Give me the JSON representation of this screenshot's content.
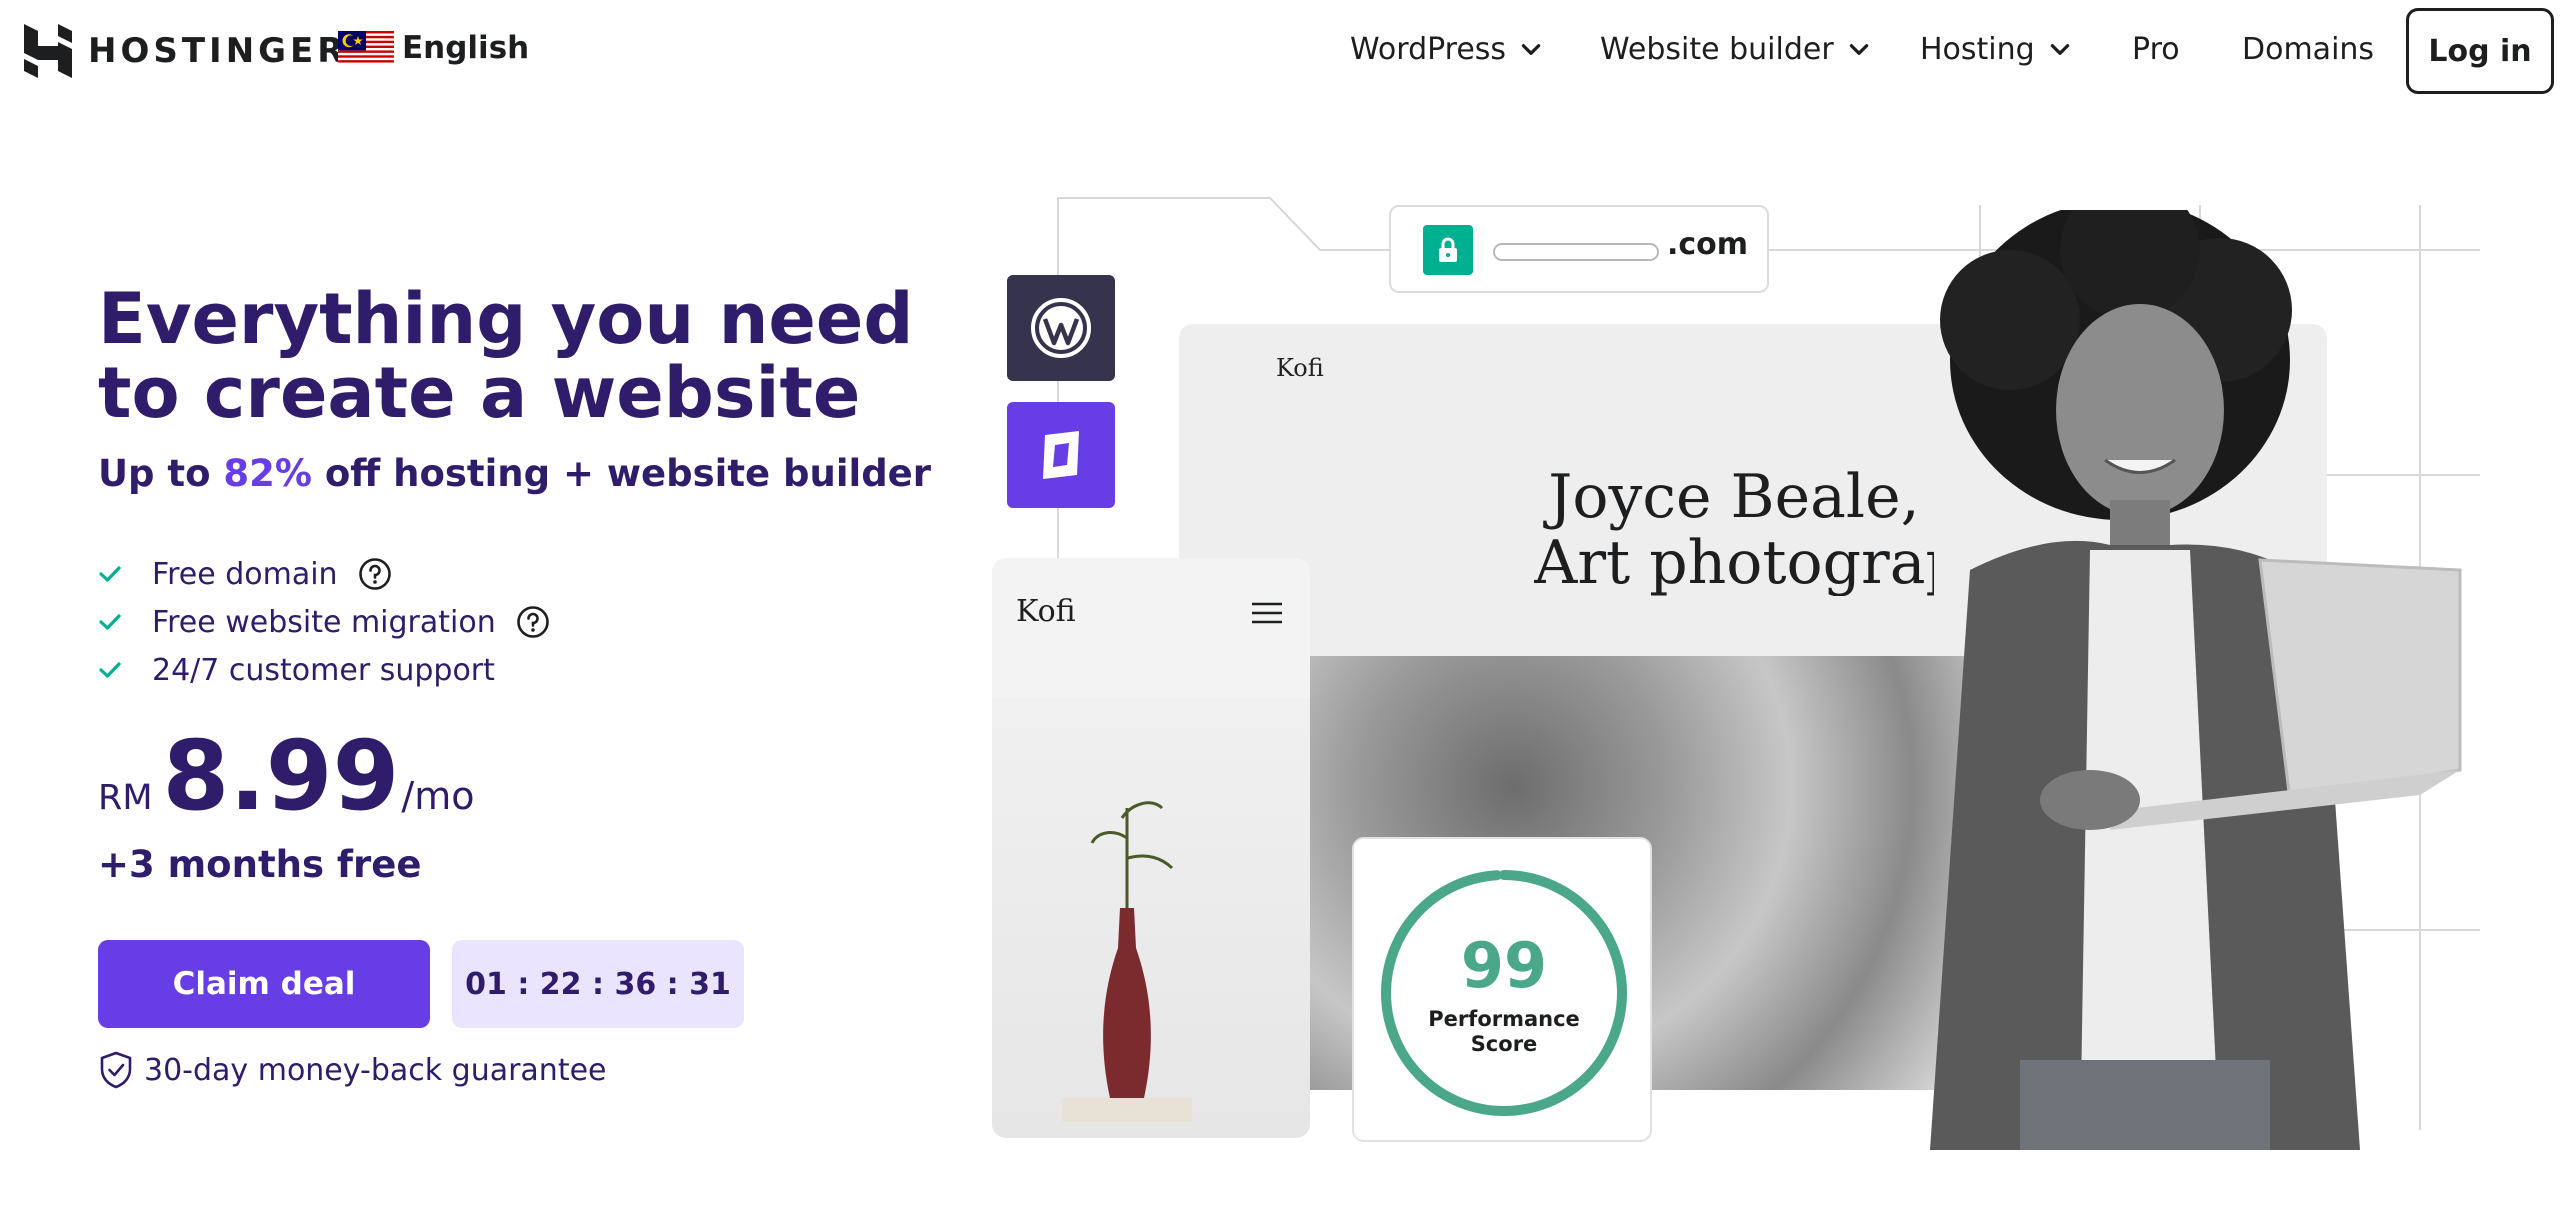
{
  "header": {
    "logo_text": "HOSTINGER",
    "language": "English",
    "nav": [
      {
        "label": "WordPress",
        "has_dropdown": true
      },
      {
        "label": "Website builder",
        "has_dropdown": true
      },
      {
        "label": "Hosting",
        "has_dropdown": true
      },
      {
        "label": "Pro",
        "has_dropdown": false
      },
      {
        "label": "Domains",
        "has_dropdown": false
      }
    ],
    "login_label": "Log in"
  },
  "hero": {
    "title": "Everything you need to create a website",
    "subtitle_prefix": "Up to ",
    "subtitle_discount": "82%",
    "subtitle_suffix": " off hosting + website builder",
    "features": [
      "Free domain",
      "Free website migration",
      "24/7 customer support"
    ],
    "price": {
      "currency": "RM",
      "amount": "8.99",
      "period": "/mo"
    },
    "bonus": "+3 months free",
    "cta_label": "Claim deal",
    "countdown": "01 : 22 : 36 : 31",
    "guarantee": "30-day money-back guarantee"
  },
  "illustration": {
    "url_tld": ".com",
    "site_brand_desktop": "Kofi",
    "site_brand_mobile": "Kofi",
    "site_heading_line1": "Joyce Beale,",
    "site_heading_line2": "Art photograph",
    "performance_score": "99",
    "performance_value": 0.99,
    "performance_label_line1": "Performance",
    "performance_label_line2": "Score"
  },
  "colors": {
    "brand_dark": "#2f1c6a",
    "brand_primary": "#673de6",
    "timer_bg": "#ebe4ff",
    "check_green": "#00b090",
    "score_green": "#4aa78a"
  },
  "icons": {
    "logo": "hostinger-logo-icon",
    "flag": "malaysia-flag-icon",
    "dropdown": "chevron-down-icon",
    "feature": "check-icon",
    "help": "question-circle-icon",
    "guarantee": "shield-check-icon",
    "lock": "lock-icon",
    "wordpress": "wordpress-icon",
    "builder": "website-builder-icon",
    "menu": "hamburger-menu-icon"
  }
}
